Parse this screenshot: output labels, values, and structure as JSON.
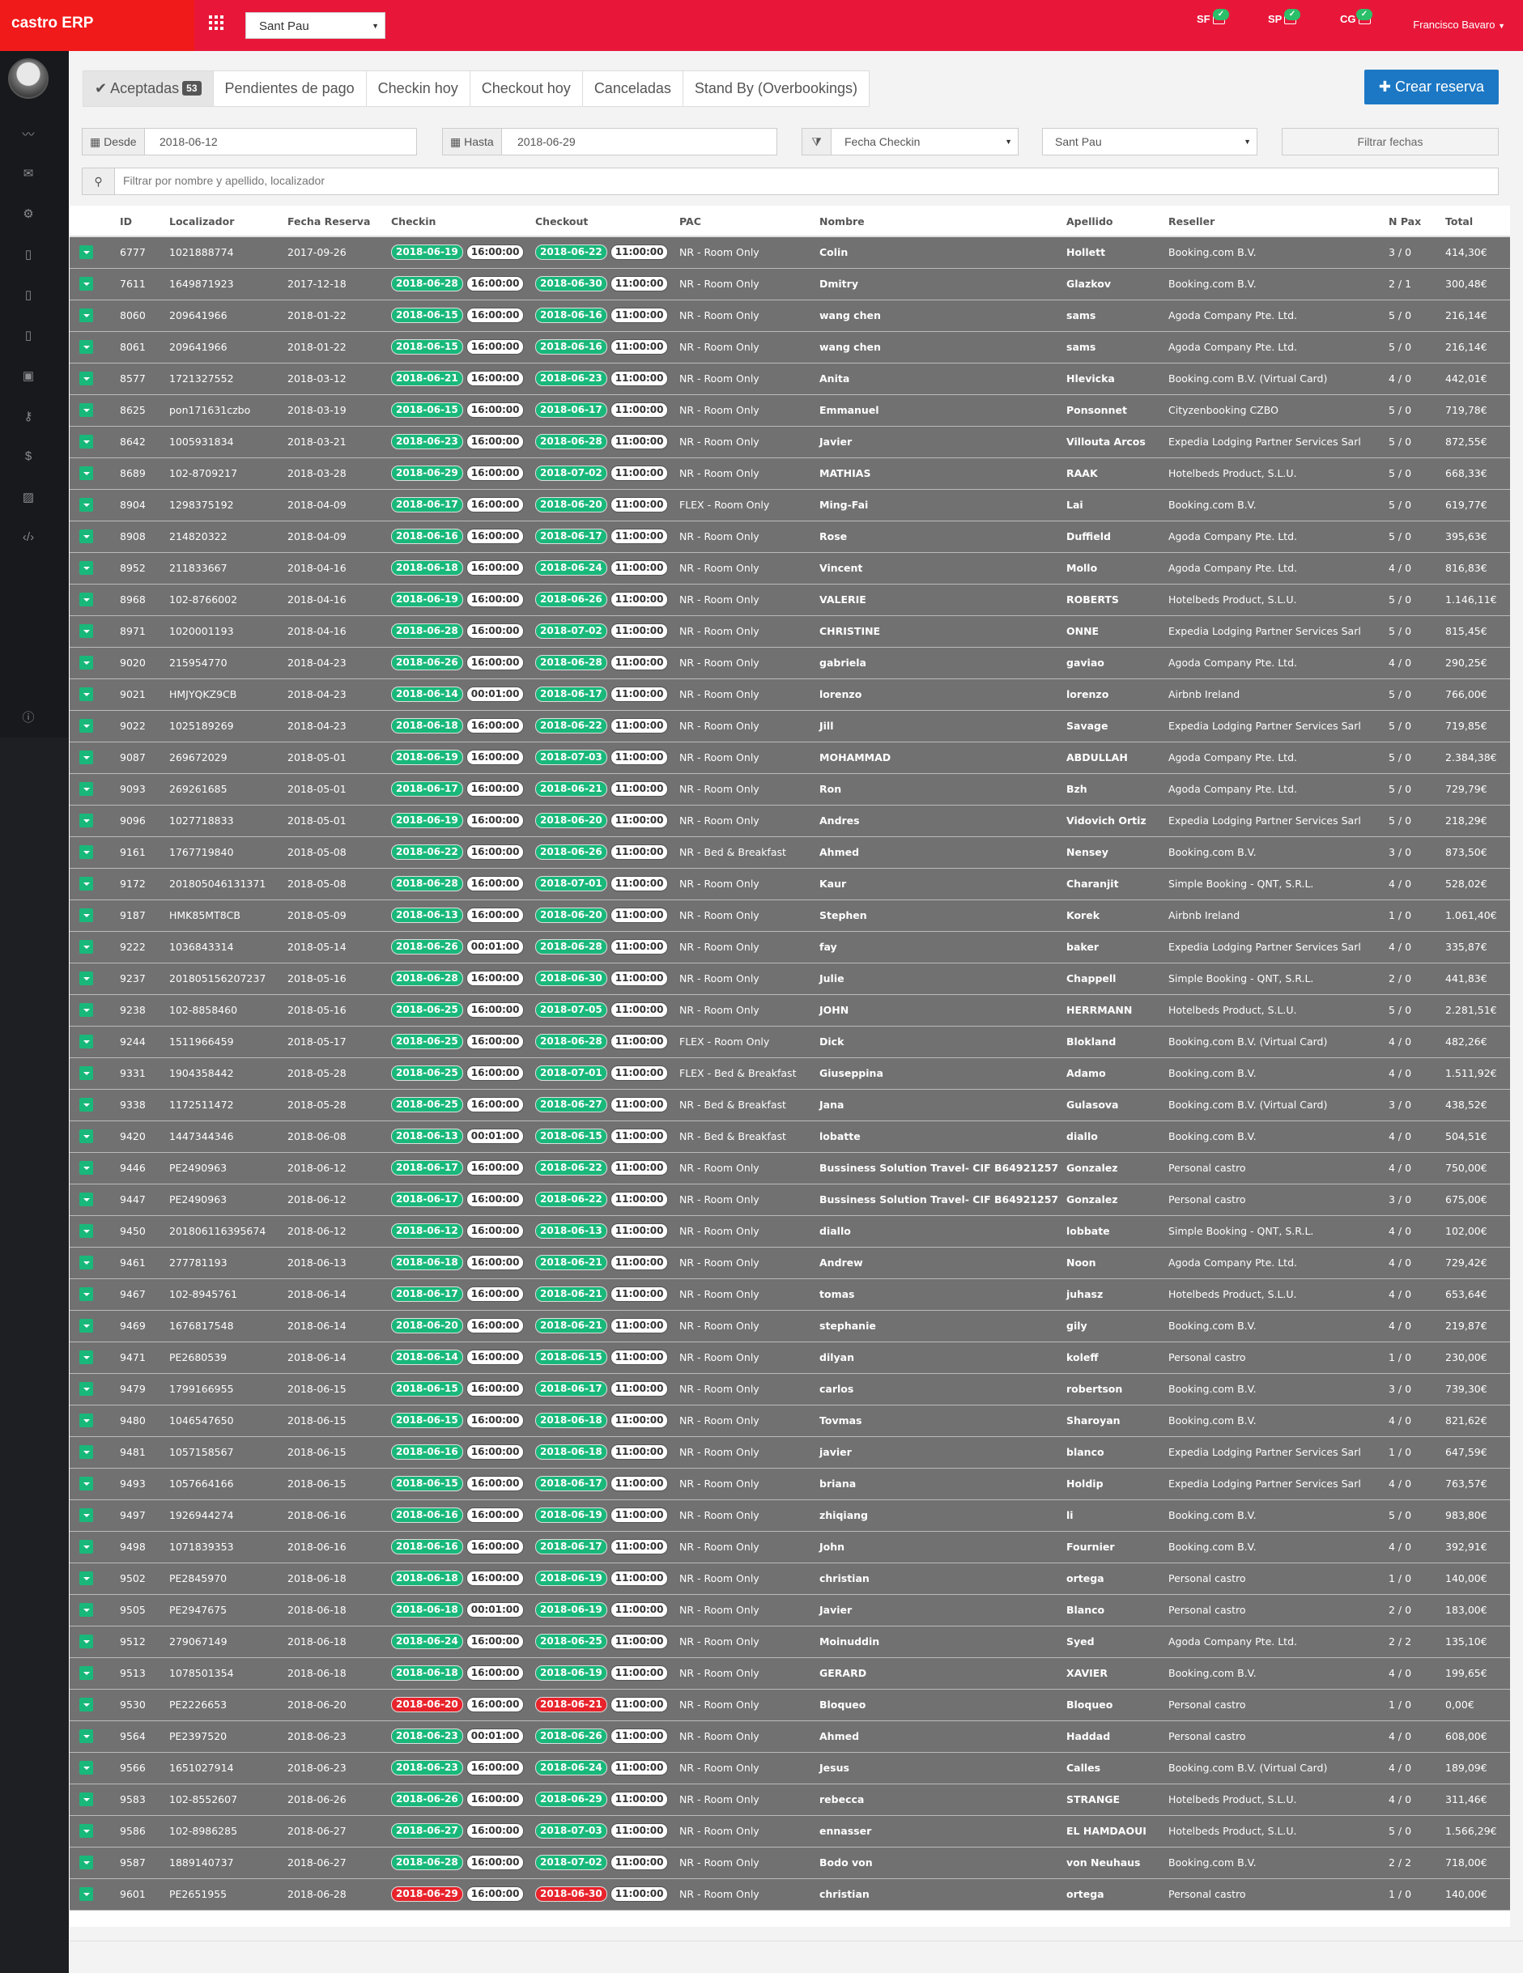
{
  "app": {
    "title": "castro ERP",
    "hotel": "Sant Pau",
    "user": "Francisco Bavaro",
    "properties": [
      "SF",
      "SP",
      "CG"
    ]
  },
  "icons": {
    "grid": "apps-grid-icon",
    "check": "check-badge-icon",
    "sidebar": [
      "dashboard-chart-icon",
      "mail-icon",
      "settings-gear-icon",
      "building-icon",
      "building-icon",
      "building-icon",
      "money-icon",
      "key-icon",
      "dollar-icon",
      "image-icon",
      "code-icon",
      "info-icon"
    ]
  },
  "colors": {
    "topbar": "#e8173a",
    "brand": "#f11a1a",
    "sidebar": "#1d1f23",
    "primary": "#1c78c4",
    "success": "#19b87a",
    "danger": "#e8232b",
    "row": "#717171"
  },
  "tabs": [
    {
      "label": "Aceptadas",
      "count": "53",
      "active": true
    },
    {
      "label": "Pendientes de pago"
    },
    {
      "label": "Checkin hoy"
    },
    {
      "label": "Checkout hoy"
    },
    {
      "label": "Canceladas"
    },
    {
      "label": "Stand By (Overbookings)"
    }
  ],
  "create_button": "Crear reserva",
  "filters": {
    "desde_label": "Desde",
    "desde": "2018-06-12",
    "hasta_label": "Hasta",
    "hasta": "2018-06-29",
    "date_field": "Fecha Checkin",
    "hotel": "Sant Pau",
    "filter_button": "Filtrar fechas",
    "search_placeholder": "Filtrar por nombre y apellido, localizador"
  },
  "columns": [
    "",
    "ID",
    "Localizador",
    "Fecha Reserva",
    "Checkin",
    "Checkout",
    "PAC",
    "Nombre",
    "Apellido",
    "Reseller",
    "N Pax",
    "Total"
  ],
  "rows": [
    [
      "6777",
      "1021888774",
      "2017-09-26",
      "2018-06-19",
      "16:00:00",
      "2018-06-22",
      "11:00:00",
      "NR - Room Only",
      "Colin",
      "Hollett",
      "Booking.com B.V.",
      "3 / 0",
      "414,30€",
      "g"
    ],
    [
      "7611",
      "1649871923",
      "2017-12-18",
      "2018-06-28",
      "16:00:00",
      "2018-06-30",
      "11:00:00",
      "NR - Room Only",
      "Dmitry",
      "Glazkov",
      "Booking.com B.V.",
      "2 / 1",
      "300,48€",
      "g"
    ],
    [
      "8060",
      "209641966",
      "2018-01-22",
      "2018-06-15",
      "16:00:00",
      "2018-06-16",
      "11:00:00",
      "NR - Room Only",
      "wang chen",
      "sams",
      "Agoda Company Pte. Ltd.",
      "5 / 0",
      "216,14€",
      "g"
    ],
    [
      "8061",
      "209641966",
      "2018-01-22",
      "2018-06-15",
      "16:00:00",
      "2018-06-16",
      "11:00:00",
      "NR - Room Only",
      "wang chen",
      "sams",
      "Agoda Company Pte. Ltd.",
      "5 / 0",
      "216,14€",
      "g"
    ],
    [
      "8577",
      "1721327552",
      "2018-03-12",
      "2018-06-21",
      "16:00:00",
      "2018-06-23",
      "11:00:00",
      "NR - Room Only",
      "Anita",
      "Hlevicka",
      "Booking.com B.V. (Virtual Card)",
      "4 / 0",
      "442,01€",
      "g"
    ],
    [
      "8625",
      "pon171631czbo",
      "2018-03-19",
      "2018-06-15",
      "16:00:00",
      "2018-06-17",
      "11:00:00",
      "NR - Room Only",
      "Emmanuel",
      "Ponsonnet",
      "Cityzenbooking CZBO",
      "5 / 0",
      "719,78€",
      "g"
    ],
    [
      "8642",
      "1005931834",
      "2018-03-21",
      "2018-06-23",
      "16:00:00",
      "2018-06-28",
      "11:00:00",
      "NR - Room Only",
      "Javier",
      "Villouta Arcos",
      "Expedia Lodging Partner Services Sarl",
      "5 / 0",
      "872,55€",
      "g"
    ],
    [
      "8689",
      "102-8709217",
      "2018-03-28",
      "2018-06-29",
      "16:00:00",
      "2018-07-02",
      "11:00:00",
      "NR - Room Only",
      "MATHIAS",
      "RAAK",
      "Hotelbeds Product, S.L.U.",
      "5 / 0",
      "668,33€",
      "g"
    ],
    [
      "8904",
      "1298375192",
      "2018-04-09",
      "2018-06-17",
      "16:00:00",
      "2018-06-20",
      "11:00:00",
      "FLEX - Room Only",
      "Ming-Fai",
      "Lai",
      "Booking.com B.V.",
      "5 / 0",
      "619,77€",
      "g"
    ],
    [
      "8908",
      "214820322",
      "2018-04-09",
      "2018-06-16",
      "16:00:00",
      "2018-06-17",
      "11:00:00",
      "NR - Room Only",
      "Rose",
      "Duffield",
      "Agoda Company Pte. Ltd.",
      "5 / 0",
      "395,63€",
      "g"
    ],
    [
      "8952",
      "211833667",
      "2018-04-16",
      "2018-06-18",
      "16:00:00",
      "2018-06-24",
      "11:00:00",
      "NR - Room Only",
      "Vincent",
      "Mollo",
      "Agoda Company Pte. Ltd.",
      "4 / 0",
      "816,83€",
      "g"
    ],
    [
      "8968",
      "102-8766002",
      "2018-04-16",
      "2018-06-19",
      "16:00:00",
      "2018-06-26",
      "11:00:00",
      "NR - Room Only",
      "VALERIE",
      "ROBERTS",
      "Hotelbeds Product, S.L.U.",
      "5 / 0",
      "1.146,11€",
      "g"
    ],
    [
      "8971",
      "1020001193",
      "2018-04-16",
      "2018-06-28",
      "16:00:00",
      "2018-07-02",
      "11:00:00",
      "NR - Room Only",
      "CHRISTINE",
      "ONNE",
      "Expedia Lodging Partner Services Sarl",
      "5 / 0",
      "815,45€",
      "g"
    ],
    [
      "9020",
      "215954770",
      "2018-04-23",
      "2018-06-26",
      "16:00:00",
      "2018-06-28",
      "11:00:00",
      "NR - Room Only",
      "gabriela",
      "gaviao",
      "Agoda Company Pte. Ltd.",
      "4 / 0",
      "290,25€",
      "g"
    ],
    [
      "9021",
      "HMJYQKZ9CB",
      "2018-04-23",
      "2018-06-14",
      "00:01:00",
      "2018-06-17",
      "11:00:00",
      "NR - Room Only",
      "lorenzo",
      "lorenzo",
      "Airbnb Ireland",
      "5 / 0",
      "766,00€",
      "g"
    ],
    [
      "9022",
      "1025189269",
      "2018-04-23",
      "2018-06-18",
      "16:00:00",
      "2018-06-22",
      "11:00:00",
      "NR - Room Only",
      "Jill",
      "Savage",
      "Expedia Lodging Partner Services Sarl",
      "5 / 0",
      "719,85€",
      "g"
    ],
    [
      "9087",
      "269672029",
      "2018-05-01",
      "2018-06-19",
      "16:00:00",
      "2018-07-03",
      "11:00:00",
      "NR - Room Only",
      "MOHAMMAD",
      "ABDULLAH",
      "Agoda Company Pte. Ltd.",
      "5 / 0",
      "2.384,38€",
      "g"
    ],
    [
      "9093",
      "269261685",
      "2018-05-01",
      "2018-06-17",
      "16:00:00",
      "2018-06-21",
      "11:00:00",
      "NR - Room Only",
      "Ron",
      "Bzh",
      "Agoda Company Pte. Ltd.",
      "5 / 0",
      "729,79€",
      "g"
    ],
    [
      "9096",
      "1027718833",
      "2018-05-01",
      "2018-06-19",
      "16:00:00",
      "2018-06-20",
      "11:00:00",
      "NR - Room Only",
      "Andres",
      "Vidovich Ortiz",
      "Expedia Lodging Partner Services Sarl",
      "5 / 0",
      "218,29€",
      "g"
    ],
    [
      "9161",
      "1767719840",
      "2018-05-08",
      "2018-06-22",
      "16:00:00",
      "2018-06-26",
      "11:00:00",
      "NR - Bed & Breakfast",
      "Ahmed",
      "Nensey",
      "Booking.com B.V.",
      "3 / 0",
      "873,50€",
      "g"
    ],
    [
      "9172",
      "201805046131371",
      "2018-05-08",
      "2018-06-28",
      "16:00:00",
      "2018-07-01",
      "11:00:00",
      "NR - Room Only",
      "Kaur",
      "Charanjit",
      "Simple Booking - QNT, S.R.L.",
      "4 / 0",
      "528,02€",
      "g"
    ],
    [
      "9187",
      "HMK85MT8CB",
      "2018-05-09",
      "2018-06-13",
      "16:00:00",
      "2018-06-20",
      "11:00:00",
      "NR - Room Only",
      "Stephen",
      "Korek",
      "Airbnb Ireland",
      "1 / 0",
      "1.061,40€",
      "g"
    ],
    [
      "9222",
      "1036843314",
      "2018-05-14",
      "2018-06-26",
      "00:01:00",
      "2018-06-28",
      "11:00:00",
      "NR - Room Only",
      "fay",
      "baker",
      "Expedia Lodging Partner Services Sarl",
      "4 / 0",
      "335,87€",
      "g"
    ],
    [
      "9237",
      "201805156207237",
      "2018-05-16",
      "2018-06-28",
      "16:00:00",
      "2018-06-30",
      "11:00:00",
      "NR - Room Only",
      "Julie",
      "Chappell",
      "Simple Booking - QNT, S.R.L.",
      "2 / 0",
      "441,83€",
      "g"
    ],
    [
      "9238",
      "102-8858460",
      "2018-05-16",
      "2018-06-25",
      "16:00:00",
      "2018-07-05",
      "11:00:00",
      "NR - Room Only",
      "JOHN",
      "HERRMANN",
      "Hotelbeds Product, S.L.U.",
      "5 / 0",
      "2.281,51€",
      "g"
    ],
    [
      "9244",
      "1511966459",
      "2018-05-17",
      "2018-06-25",
      "16:00:00",
      "2018-06-28",
      "11:00:00",
      "FLEX - Room Only",
      "Dick",
      "Blokland",
      "Booking.com B.V. (Virtual Card)",
      "4 / 0",
      "482,26€",
      "g"
    ],
    [
      "9331",
      "1904358442",
      "2018-05-28",
      "2018-06-25",
      "16:00:00",
      "2018-07-01",
      "11:00:00",
      "FLEX - Bed & Breakfast",
      "Giuseppina",
      "Adamo",
      "Booking.com B.V.",
      "4 / 0",
      "1.511,92€",
      "g"
    ],
    [
      "9338",
      "1172511472",
      "2018-05-28",
      "2018-06-25",
      "16:00:00",
      "2018-06-27",
      "11:00:00",
      "NR - Bed & Breakfast",
      "Jana",
      "Gulasova",
      "Booking.com B.V. (Virtual Card)",
      "3 / 0",
      "438,52€",
      "g"
    ],
    [
      "9420",
      "1447344346",
      "2018-06-08",
      "2018-06-13",
      "00:01:00",
      "2018-06-15",
      "11:00:00",
      "NR - Bed & Breakfast",
      "lobatte",
      "diallo",
      "Booking.com B.V.",
      "4 / 0",
      "504,51€",
      "g"
    ],
    [
      "9446",
      "PE2490963",
      "2018-06-12",
      "2018-06-17",
      "16:00:00",
      "2018-06-22",
      "11:00:00",
      "NR - Room Only",
      "Bussiness Solution Travel- CIF B64921257",
      "Gonzalez",
      "Personal castro",
      "4 / 0",
      "750,00€",
      "g"
    ],
    [
      "9447",
      "PE2490963",
      "2018-06-12",
      "2018-06-17",
      "16:00:00",
      "2018-06-22",
      "11:00:00",
      "NR - Room Only",
      "Bussiness Solution Travel- CIF B64921257",
      "Gonzalez",
      "Personal castro",
      "3 / 0",
      "675,00€",
      "g"
    ],
    [
      "9450",
      "201806116395674",
      "2018-06-12",
      "2018-06-12",
      "16:00:00",
      "2018-06-13",
      "11:00:00",
      "NR - Room Only",
      "diallo",
      "lobbate",
      "Simple Booking - QNT, S.R.L.",
      "4 / 0",
      "102,00€",
      "g"
    ],
    [
      "9461",
      "277781193",
      "2018-06-13",
      "2018-06-18",
      "16:00:00",
      "2018-06-21",
      "11:00:00",
      "NR - Room Only",
      "Andrew",
      "Noon",
      "Agoda Company Pte. Ltd.",
      "4 / 0",
      "729,42€",
      "g"
    ],
    [
      "9467",
      "102-8945761",
      "2018-06-14",
      "2018-06-17",
      "16:00:00",
      "2018-06-21",
      "11:00:00",
      "NR - Room Only",
      "tomas",
      "juhasz",
      "Hotelbeds Product, S.L.U.",
      "4 / 0",
      "653,64€",
      "g"
    ],
    [
      "9469",
      "1676817548",
      "2018-06-14",
      "2018-06-20",
      "16:00:00",
      "2018-06-21",
      "11:00:00",
      "NR - Room Only",
      "stephanie",
      "gily",
      "Booking.com B.V.",
      "4 / 0",
      "219,87€",
      "g"
    ],
    [
      "9471",
      "PE2680539",
      "2018-06-14",
      "2018-06-14",
      "16:00:00",
      "2018-06-15",
      "11:00:00",
      "NR - Room Only",
      "dilyan",
      "koleff",
      "Personal castro",
      "1 / 0",
      "230,00€",
      "g"
    ],
    [
      "9479",
      "1799166955",
      "2018-06-15",
      "2018-06-15",
      "16:00:00",
      "2018-06-17",
      "11:00:00",
      "NR - Room Only",
      "carlos",
      "robertson",
      "Booking.com B.V.",
      "3 / 0",
      "739,30€",
      "g"
    ],
    [
      "9480",
      "1046547650",
      "2018-06-15",
      "2018-06-15",
      "16:00:00",
      "2018-06-18",
      "11:00:00",
      "NR - Room Only",
      "Tovmas",
      "Sharoyan",
      "Booking.com B.V.",
      "4 / 0",
      "821,62€",
      "g"
    ],
    [
      "9481",
      "1057158567",
      "2018-06-15",
      "2018-06-16",
      "16:00:00",
      "2018-06-18",
      "11:00:00",
      "NR - Room Only",
      "javier",
      "blanco",
      "Expedia Lodging Partner Services Sarl",
      "1 / 0",
      "647,59€",
      "g"
    ],
    [
      "9493",
      "1057664166",
      "2018-06-15",
      "2018-06-15",
      "16:00:00",
      "2018-06-17",
      "11:00:00",
      "NR - Room Only",
      "briana",
      "Holdip",
      "Expedia Lodging Partner Services Sarl",
      "4 / 0",
      "763,57€",
      "g"
    ],
    [
      "9497",
      "1926944274",
      "2018-06-16",
      "2018-06-16",
      "16:00:00",
      "2018-06-19",
      "11:00:00",
      "NR - Room Only",
      "zhiqiang",
      "li",
      "Booking.com B.V.",
      "5 / 0",
      "983,80€",
      "g"
    ],
    [
      "9498",
      "1071839353",
      "2018-06-16",
      "2018-06-16",
      "16:00:00",
      "2018-06-17",
      "11:00:00",
      "NR - Room Only",
      "John",
      "Fournier",
      "Booking.com B.V.",
      "4 / 0",
      "392,91€",
      "g"
    ],
    [
      "9502",
      "PE2845970",
      "2018-06-18",
      "2018-06-18",
      "16:00:00",
      "2018-06-19",
      "11:00:00",
      "NR - Room Only",
      "christian",
      "ortega",
      "Personal castro",
      "1 / 0",
      "140,00€",
      "g"
    ],
    [
      "9505",
      "PE2947675",
      "2018-06-18",
      "2018-06-18",
      "00:01:00",
      "2018-06-19",
      "11:00:00",
      "NR - Room Only",
      "Javier",
      "Blanco",
      "Personal castro",
      "2 / 0",
      "183,00€",
      "g"
    ],
    [
      "9512",
      "279067149",
      "2018-06-18",
      "2018-06-24",
      "16:00:00",
      "2018-06-25",
      "11:00:00",
      "NR - Room Only",
      "Moinuddin",
      "Syed",
      "Agoda Company Pte. Ltd.",
      "2 / 2",
      "135,10€",
      "g"
    ],
    [
      "9513",
      "1078501354",
      "2018-06-18",
      "2018-06-18",
      "16:00:00",
      "2018-06-19",
      "11:00:00",
      "NR - Room Only",
      "GERARD",
      "XAVIER",
      "Booking.com B.V.",
      "4 / 0",
      "199,65€",
      "g"
    ],
    [
      "9530",
      "PE2226653",
      "2018-06-20",
      "2018-06-20",
      "16:00:00",
      "2018-06-21",
      "11:00:00",
      "NR - Room Only",
      "Bloqueo",
      "Bloqueo",
      "Personal castro",
      "1 / 0",
      "0,00€",
      "r"
    ],
    [
      "9564",
      "PE2397520",
      "2018-06-23",
      "2018-06-23",
      "00:01:00",
      "2018-06-26",
      "11:00:00",
      "NR - Room Only",
      "Ahmed",
      "Haddad",
      "Personal castro",
      "4 / 0",
      "608,00€",
      "g"
    ],
    [
      "9566",
      "1651027914",
      "2018-06-23",
      "2018-06-23",
      "16:00:00",
      "2018-06-24",
      "11:00:00",
      "NR - Room Only",
      "Jesus",
      "Calles",
      "Booking.com B.V. (Virtual Card)",
      "4 / 0",
      "189,09€",
      "g"
    ],
    [
      "9583",
      "102-8552607",
      "2018-06-26",
      "2018-06-26",
      "16:00:00",
      "2018-06-29",
      "11:00:00",
      "NR - Room Only",
      "rebecca",
      "STRANGE",
      "Hotelbeds Product, S.L.U.",
      "4 / 0",
      "311,46€",
      "g"
    ],
    [
      "9586",
      "102-8986285",
      "2018-06-27",
      "2018-06-27",
      "16:00:00",
      "2018-07-03",
      "11:00:00",
      "NR - Room Only",
      "ennasser",
      "EL HAMDAOUI",
      "Hotelbeds Product, S.L.U.",
      "5 / 0",
      "1.566,29€",
      "g"
    ],
    [
      "9587",
      "1889140737",
      "2018-06-27",
      "2018-06-28",
      "16:00:00",
      "2018-07-02",
      "11:00:00",
      "NR - Room Only",
      "Bodo von",
      "von Neuhaus",
      "Booking.com B.V.",
      "2 / 2",
      "718,00€",
      "g"
    ],
    [
      "9601",
      "PE2651955",
      "2018-06-28",
      "2018-06-29",
      "16:00:00",
      "2018-06-30",
      "11:00:00",
      "NR - Room Only",
      "christian",
      "ortega",
      "Personal castro",
      "1 / 0",
      "140,00€",
      "r"
    ]
  ]
}
